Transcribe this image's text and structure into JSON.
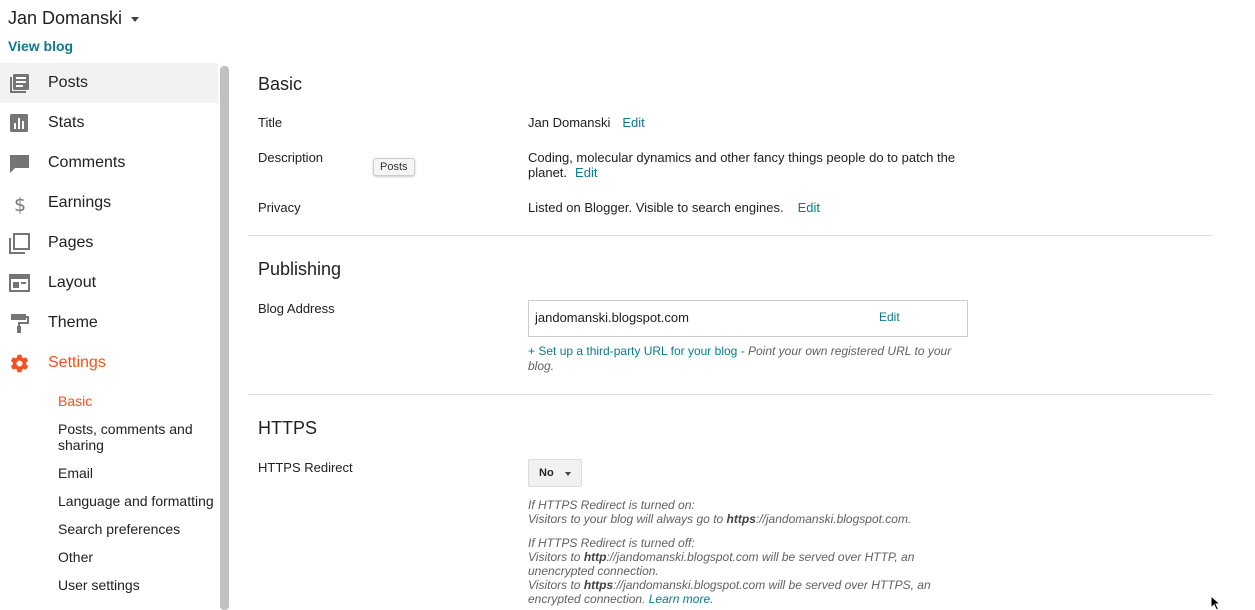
{
  "header": {
    "blog_name": "Jan Domanski",
    "view_blog_label": "View blog"
  },
  "sidebar": {
    "items": [
      {
        "label": "Posts",
        "icon": "posts-icon"
      },
      {
        "label": "Stats",
        "icon": "stats-icon"
      },
      {
        "label": "Comments",
        "icon": "comments-icon"
      },
      {
        "label": "Earnings",
        "icon": "dollar-icon"
      },
      {
        "label": "Pages",
        "icon": "pages-icon"
      },
      {
        "label": "Layout",
        "icon": "layout-icon"
      },
      {
        "label": "Theme",
        "icon": "paint-roller-icon"
      },
      {
        "label": "Settings",
        "icon": "gear-icon"
      }
    ],
    "settings_subitems": [
      {
        "label": "Basic"
      },
      {
        "label": "Posts, comments and sharing"
      },
      {
        "label": "Email"
      },
      {
        "label": "Language and formatting"
      },
      {
        "label": "Search preferences"
      },
      {
        "label": "Other"
      },
      {
        "label": "User settings"
      }
    ]
  },
  "tooltip": {
    "text": "Posts"
  },
  "basic": {
    "title": "Basic",
    "title_label": "Title",
    "title_value": "Jan Domanski",
    "description_label": "Description",
    "description_value": "Coding, molecular dynamics and other fancy things people do to patch the planet.",
    "privacy_label": "Privacy",
    "privacy_value": "Listed on Blogger. Visible to search engines.",
    "edit_label": "Edit"
  },
  "publishing": {
    "title": "Publishing",
    "address_label": "Blog Address",
    "address_value": "jandomanski.blogspot.com",
    "edit_label": "Edit",
    "third_party_link": "+ Set up a third-party URL for your blog",
    "third_party_text": " - Point your own registered URL to your blog."
  },
  "https": {
    "title": "HTTPS",
    "redirect_label": "HTTPS Redirect",
    "redirect_value": "No",
    "on_heading": "If HTTPS Redirect is turned on:",
    "on_text_prefix": "Visitors to your blog will always go to ",
    "on_text_bold": "https",
    "on_text_suffix": "://jandomanski.blogspot.com.",
    "off_heading": "If HTTPS Redirect is turned off:",
    "off_http_prefix": "Visitors to ",
    "off_http_bold": "http",
    "off_http_suffix": "://jandomanski.blogspot.com will be served over HTTP, an unencrypted connection.",
    "off_https_prefix": "Visitors to ",
    "off_https_bold": "https",
    "off_https_suffix": "://jandomanski.blogspot.com will be served over HTTPS, an encrypted connection. ",
    "learn_more": "Learn more."
  }
}
